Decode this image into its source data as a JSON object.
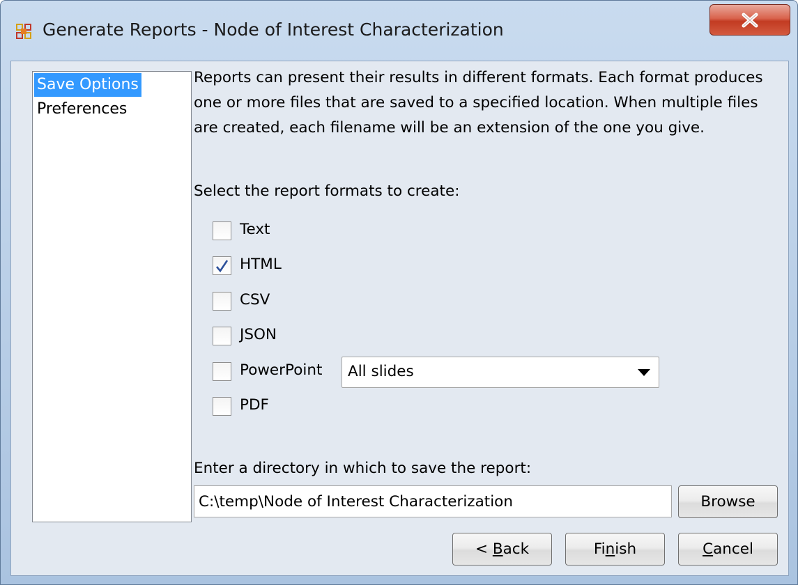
{
  "window": {
    "title": "Generate Reports - Node of Interest Characterization"
  },
  "nav": {
    "items": [
      {
        "label": "Save Options",
        "selected": true
      },
      {
        "label": "Preferences",
        "selected": false
      }
    ]
  },
  "main": {
    "description": "Reports can present their results in different formats. Each format produces one or more files that are saved to a specified location. When multiple files are created, each filename will be an extension of the one you give.",
    "formats_prompt": "Select the report formats to create:",
    "formats": [
      {
        "label": "Text",
        "checked": false
      },
      {
        "label": "HTML",
        "checked": true
      },
      {
        "label": "CSV",
        "checked": false
      },
      {
        "label": "JSON",
        "checked": false
      },
      {
        "label": "PowerPoint",
        "checked": false
      },
      {
        "label": "PDF",
        "checked": false
      }
    ],
    "powerpoint_option": "All slides",
    "directory_prompt": "Enter a directory in which to save the report:",
    "directory_value": "C:\\temp\\Node of Interest Characterization",
    "browse_label": "Browse"
  },
  "buttons": {
    "back_prefix": "< ",
    "back_mnemonic": "B",
    "back_rest": "ack",
    "finish_prefix": "Fi",
    "finish_mnemonic": "n",
    "finish_rest": "ish",
    "cancel_prefix": "",
    "cancel_mnemonic": "C",
    "cancel_rest": "ancel"
  },
  "icons": {
    "app": "app-grid-icon",
    "close": "close-icon",
    "check": "checkmark-icon",
    "dropdown": "dropdown-arrow-icon"
  },
  "colors": {
    "selection": "#3399ff",
    "close_button": "#c23b22",
    "checkmark": "#2b4f9a"
  }
}
